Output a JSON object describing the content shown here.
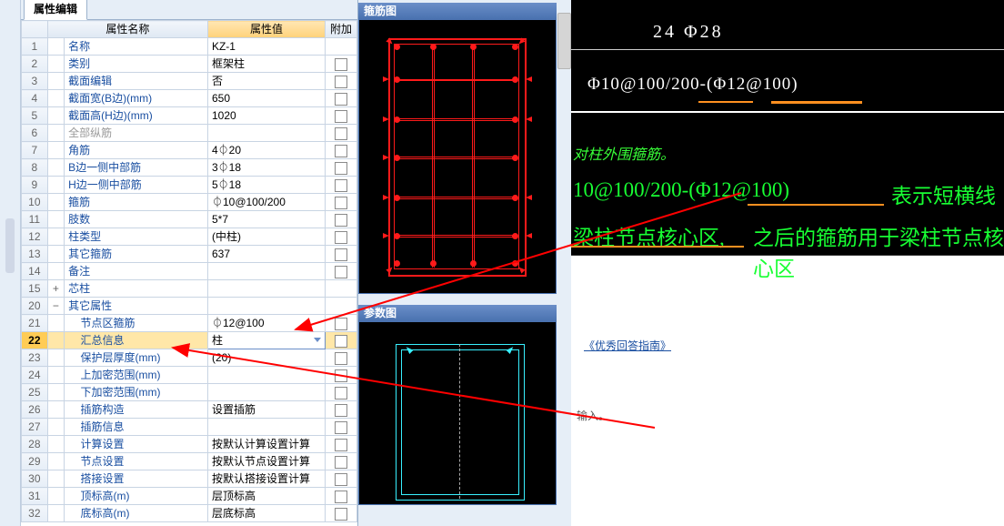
{
  "tab": "属性编辑",
  "headers": {
    "name": "属性名称",
    "value": "属性值",
    "add": "附加"
  },
  "rows": [
    {
      "n": 1,
      "lv": 0,
      "name": "名称",
      "val": "KZ-1",
      "blue": true,
      "chk": false
    },
    {
      "n": 2,
      "lv": 0,
      "name": "类别",
      "val": "框架柱",
      "blue": true,
      "chk": true
    },
    {
      "n": 3,
      "lv": 0,
      "name": "截面编辑",
      "val": "否",
      "blue": true,
      "chk": true
    },
    {
      "n": 4,
      "lv": 0,
      "name": "截面宽(B边)(mm)",
      "val": "650",
      "blue": true,
      "chk": true
    },
    {
      "n": 5,
      "lv": 0,
      "name": "截面高(H边)(mm)",
      "val": "1020",
      "blue": true,
      "chk": true
    },
    {
      "n": 6,
      "lv": 0,
      "name": "全部纵筋",
      "val": "",
      "blue": false,
      "chk": true
    },
    {
      "n": 7,
      "lv": 0,
      "name": "角筋",
      "val": "4⏀20",
      "blue": true,
      "chk": true
    },
    {
      "n": 8,
      "lv": 0,
      "name": "B边一侧中部筋",
      "val": "3⏀18",
      "blue": true,
      "chk": true
    },
    {
      "n": 9,
      "lv": 0,
      "name": "H边一侧中部筋",
      "val": "5⏀18",
      "blue": true,
      "chk": true
    },
    {
      "n": 10,
      "lv": 0,
      "name": "箍筋",
      "val": "⏀10@100/200",
      "blue": true,
      "chk": true
    },
    {
      "n": 11,
      "lv": 0,
      "name": "肢数",
      "val": "5*7",
      "blue": true,
      "chk": true
    },
    {
      "n": 12,
      "lv": 0,
      "name": "柱类型",
      "val": "(中柱)",
      "blue": true,
      "chk": true
    },
    {
      "n": 13,
      "lv": 0,
      "name": "其它箍筋",
      "val": "637",
      "blue": true,
      "chk": true
    },
    {
      "n": 14,
      "lv": 0,
      "name": "备注",
      "val": "",
      "blue": true,
      "chk": true
    },
    {
      "n": 15,
      "lv": 0,
      "name": "芯柱",
      "val": "",
      "blue": true,
      "chk": false,
      "exp": "+"
    },
    {
      "n": 20,
      "lv": 0,
      "name": "其它属性",
      "val": "",
      "blue": true,
      "chk": false,
      "exp": "−"
    },
    {
      "n": 21,
      "lv": 1,
      "name": "节点区箍筋",
      "val": "⏀12@100",
      "blue": true,
      "chk": true
    },
    {
      "n": 22,
      "lv": 1,
      "name": "汇总信息",
      "val": "柱",
      "blue": true,
      "chk": true,
      "sel": true
    },
    {
      "n": 23,
      "lv": 1,
      "name": "保护层厚度(mm)",
      "val": "(20)",
      "blue": true,
      "chk": true
    },
    {
      "n": 24,
      "lv": 1,
      "name": "上加密范围(mm)",
      "val": "",
      "blue": true,
      "chk": true
    },
    {
      "n": 25,
      "lv": 1,
      "name": "下加密范围(mm)",
      "val": "",
      "blue": true,
      "chk": true
    },
    {
      "n": 26,
      "lv": 1,
      "name": "插筋构造",
      "val": "设置插筋",
      "blue": true,
      "chk": true
    },
    {
      "n": 27,
      "lv": 1,
      "name": "插筋信息",
      "val": "",
      "blue": true,
      "chk": true
    },
    {
      "n": 28,
      "lv": 1,
      "name": "计算设置",
      "val": "按默认计算设置计算",
      "blue": true,
      "chk": true
    },
    {
      "n": 29,
      "lv": 1,
      "name": "节点设置",
      "val": "按默认节点设置计算",
      "blue": true,
      "chk": true
    },
    {
      "n": 30,
      "lv": 1,
      "name": "搭接设置",
      "val": "按默认搭接设置计算",
      "blue": true,
      "chk": true
    },
    {
      "n": 31,
      "lv": 1,
      "name": "顶标高(m)",
      "val": "层顶标高",
      "blue": true,
      "chk": true
    },
    {
      "n": 32,
      "lv": 1,
      "name": "底标高(m)",
      "val": "层底标高",
      "blue": true,
      "chk": true
    }
  ],
  "panels": {
    "stirrup": "箍筋图",
    "param": "参数图"
  },
  "cad": {
    "l1": "24 Φ28",
    "l2": "Φ10@100/200-(Φ12@100)",
    "l3_a": "10@100/200-(Φ12@100)",
    "l3_b": "表示短横线",
    "l4_a": "梁柱节点核心区,",
    "l4_b": "之后的箍筋用于梁柱节点核心区"
  },
  "link": "《优秀回答指南》",
  "hint": "输入。"
}
